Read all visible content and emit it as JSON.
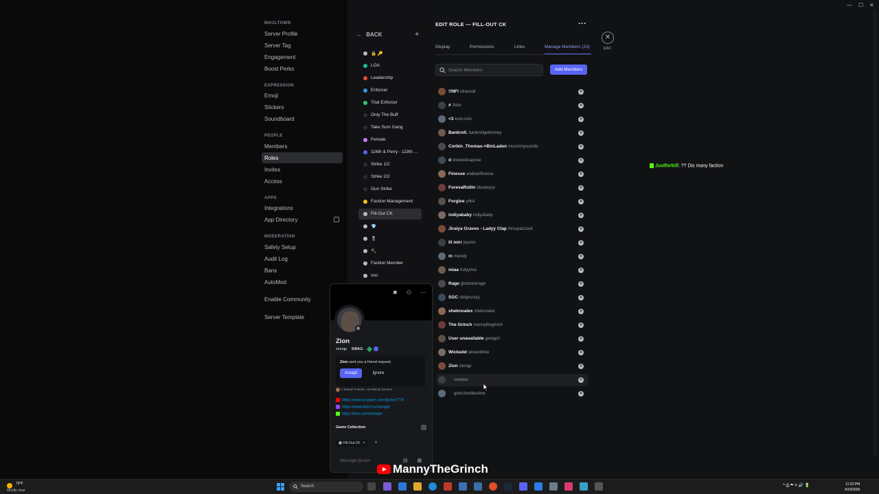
{
  "sidebar": {
    "categories": [
      {
        "label": "MAULTOWN"
      },
      {
        "label": "EXPRESSION"
      },
      {
        "label": "PEOPLE"
      },
      {
        "label": "APPS"
      },
      {
        "label": "MODERATION"
      }
    ],
    "items": [
      {
        "label": "Server Profile"
      },
      {
        "label": "Server Tag"
      },
      {
        "label": "Engagement"
      },
      {
        "label": "Boost Perks"
      },
      {
        "label": "Emoji"
      },
      {
        "label": "Stickers"
      },
      {
        "label": "Soundboard"
      },
      {
        "label": "Members"
      },
      {
        "label": "Roles"
      },
      {
        "label": "Invites"
      },
      {
        "label": "Access"
      },
      {
        "label": "Integrations"
      },
      {
        "label": "App Directory"
      },
      {
        "label": "Safety Setup"
      },
      {
        "label": "Audit Log"
      },
      {
        "label": "Bans"
      },
      {
        "label": "AutoMod"
      },
      {
        "label": "Enable Community"
      },
      {
        "label": "Server Template"
      }
    ]
  },
  "roles_panel": {
    "back_label": "BACK",
    "add_icon": "plus-icon",
    "roles": [
      {
        "name": "🔒 🔑",
        "color": "#b5bac1"
      },
      {
        "name": "LOA",
        "color": "#1abc9c"
      },
      {
        "name": "Leadership",
        "color": "#e74c3c"
      },
      {
        "name": "Enforcer",
        "color": "#3498db"
      },
      {
        "name": "Trial Enforcer",
        "color": "#2ecc71"
      },
      {
        "name": "Only The Buff",
        "color": "#2b2d31"
      },
      {
        "name": "Take Sum Gang",
        "color": "#2b2d31"
      },
      {
        "name": "Female",
        "color": "#c77dff"
      },
      {
        "name": "116th & Perry - 119th ...",
        "color": "#5865f2"
      },
      {
        "name": "Strike 1/2",
        "color": "#2b2d31"
      },
      {
        "name": "Strike 2/2",
        "color": "#2b2d31"
      },
      {
        "name": "Gun Strike",
        "color": "#2b2d31"
      },
      {
        "name": "Faction Management",
        "color": "#f1c40f"
      },
      {
        "name": "Fill-Out CK",
        "color": "#b5bac1"
      },
      {
        "name": "💎",
        "color": "#b5bac1"
      },
      {
        "name": "🎖",
        "color": "#b5bac1"
      },
      {
        "name": "🔨",
        "color": "#b5bac1"
      },
      {
        "name": "Faction Member",
        "color": "#b5bac1"
      },
      {
        "name": "ooc",
        "color": "#b5bac1"
      }
    ]
  },
  "main": {
    "title": "EDIT ROLE — FILL-OUT CK",
    "more_icon": "···",
    "close_symbol": "✕",
    "esc_label": "ESC",
    "tabs": [
      {
        "label": "Display"
      },
      {
        "label": "Permissions"
      },
      {
        "label": "Links"
      },
      {
        "label": "Manage Members (23)"
      }
    ],
    "search_placeholder": "Search Members",
    "add_members_label": "Add Members",
    "remove_symbol": "×",
    "members": [
      {
        "name": "!!NF!",
        "user": "idracooli"
      },
      {
        "name": "#",
        "user": "3nito"
      },
      {
        "name": "<3",
        "user": "kunt.com"
      },
      {
        "name": "Bankroll.",
        "user": "bankrollgetmoney"
      },
      {
        "name": "Corbin_Thomas->BinLaden",
        "user": "mournmysuicide"
      },
      {
        "name": "d",
        "user": "drewskiicapone"
      },
      {
        "name": "Finesse",
        "user": "arabianfinesse"
      },
      {
        "name": "ForevaRollin",
        "user": "blueboyrp"
      },
      {
        "name": "Forgive",
        "user": "y6k4"
      },
      {
        "name": "indiyababy",
        "user": "indiyababy"
      },
      {
        "name": "Jiraiya Graves - Ladyy Clap",
        "user": "mrsspazzoutt"
      },
      {
        "name": "lil mirr",
        "user": "jeymirr"
      },
      {
        "name": "m",
        "user": "melvdy"
      },
      {
        "name": "miaa",
        "user": "trulyymia"
      },
      {
        "name": "Rage",
        "user": "glockstarrage"
      },
      {
        "name": "SGC",
        "user": "skilgocrazy"
      },
      {
        "name": "sheknoalex",
        "user": "sheknoalex"
      },
      {
        "name": "The Grinch",
        "user": "mannythegrinch"
      },
      {
        "name": "User unavailable",
        "user": "gwopp0"
      },
      {
        "name": "Wickedd",
        "user": "wickeddlive"
      },
      {
        "name": "Zion",
        "user": "zionqp"
      },
      {
        "name": "",
        "user": "covetxo"
      },
      {
        "name": "",
        "user": "getrichordiestime"
      }
    ]
  },
  "chat_overlay": {
    "username": "Justforbill",
    "message": ": ?? Dis many faction"
  },
  "profile_popout": {
    "name": "Zion",
    "username": "zionqp",
    "tag": "SWAG",
    "friend_request_user": "Zion",
    "friend_request_text": " sent you a friend request.",
    "accept_label": "Accept",
    "ignore_label": "Ignore",
    "mutual_text": "2 Mutual Friends  •  18 Mutual Servers",
    "links": [
      {
        "text": "https://www.youtube.com/@zion777k",
        "color": "#ff0000"
      },
      {
        "text": "https://www.twitch.tv/zionqpe",
        "color": "#9146ff"
      },
      {
        "text": "https://kick.com/zionqpe",
        "color": "#53fc18"
      }
    ],
    "game_collection_label": "Game Collection",
    "role_chip": "Fill-Out CK",
    "role_chip_close": "×",
    "add_role_symbol": "+",
    "message_placeholder": "Message @Zion",
    "message_icons": "▤ ▦"
  },
  "watermark": {
    "text": "MannyTheGrinch"
  },
  "window_controls": {
    "minimize": "—",
    "maximize": "☐",
    "close": "✕"
  },
  "taskbar": {
    "weather_temp": "73°F",
    "weather_desc": "Mostly clear",
    "search_label": "Search",
    "time": "11:23 PM",
    "date": "4/16/2026",
    "tray_symbols": "^  ⎙  ☁  ⌾  🔊  🔋"
  },
  "colors": {
    "accent": "#5865f2",
    "kick_green": "#53fc18",
    "youtube_red": "#ff0000"
  }
}
